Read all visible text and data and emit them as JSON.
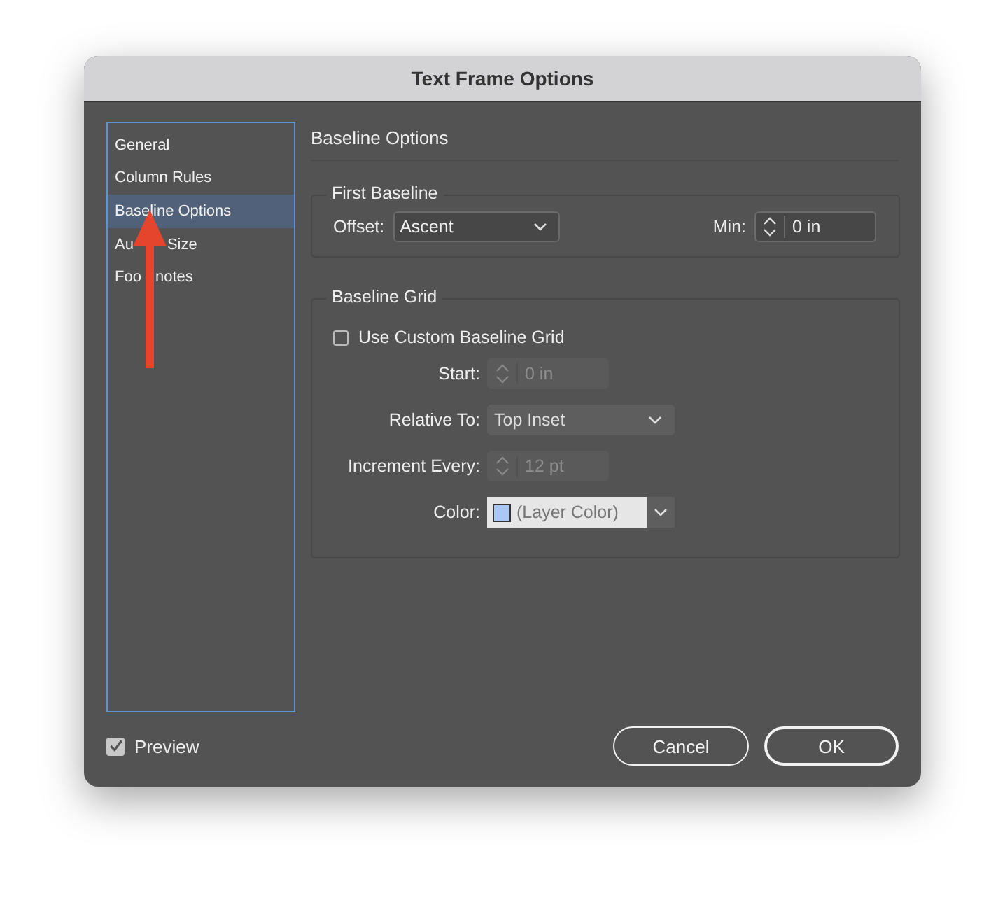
{
  "window": {
    "title": "Text Frame Options"
  },
  "sidebar": {
    "items": [
      {
        "label": "General",
        "selected": false
      },
      {
        "label": "Column Rules",
        "selected": false
      },
      {
        "label": "Baseline Options",
        "selected": true
      },
      {
        "label_parts": [
          "Au",
          "Size"
        ],
        "selected": false
      },
      {
        "label_parts": [
          "Foo",
          "notes"
        ],
        "selected": false
      }
    ]
  },
  "section_title": "Baseline Options",
  "first_baseline": {
    "title": "First Baseline",
    "offset": {
      "label": "Offset:",
      "value": "Ascent"
    },
    "min": {
      "label": "Min:",
      "value": "0 in",
      "disabled": false
    }
  },
  "baseline_grid": {
    "title": "Baseline Grid",
    "use_custom": {
      "label": "Use Custom Baseline Grid",
      "checked": false
    },
    "fields": [
      {
        "kind": "spinner",
        "label": "Start:",
        "value": "0 in",
        "disabled": true
      },
      {
        "kind": "dropdown",
        "label": "Relative To:",
        "value": "Top Inset"
      },
      {
        "kind": "spinner",
        "label": "Increment Every:",
        "value": "12 pt",
        "disabled": true
      },
      {
        "kind": "color",
        "label": "Color:",
        "value": "(Layer Color)"
      }
    ]
  },
  "preview": {
    "label": "Preview",
    "checked": true
  },
  "buttons": [
    {
      "label": "Cancel",
      "default": false
    },
    {
      "label": "OK",
      "default": true
    }
  ]
}
